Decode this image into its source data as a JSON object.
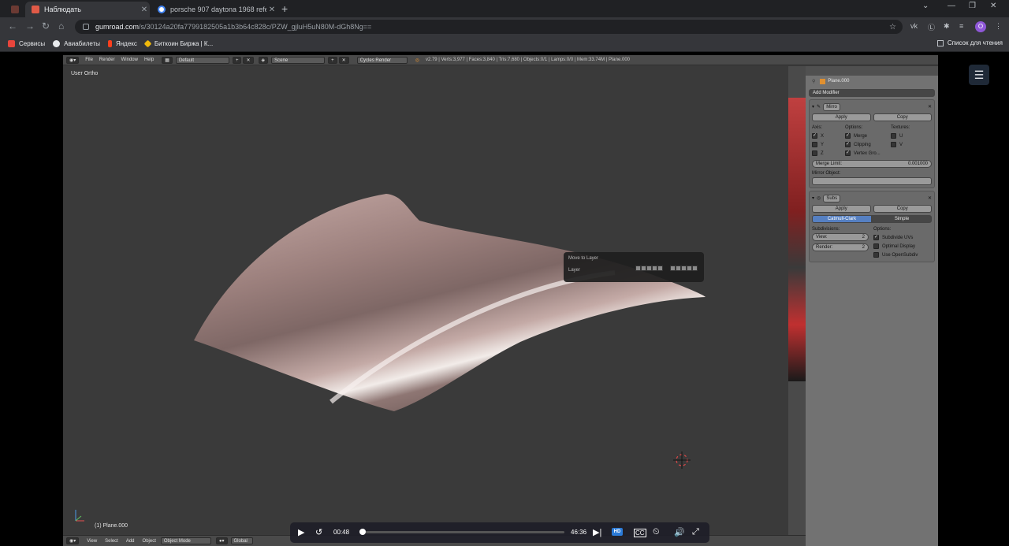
{
  "tabs": [
    {
      "label": "Наблюдать",
      "active": true,
      "favicon_color": "#e05a47"
    },
    {
      "label": "porsche 907 daytona 1968 refere",
      "active": false,
      "favicon_color": "#4285f4"
    }
  ],
  "address": {
    "host": "gumroad.com",
    "path": "/s/30124a20fa7799182505a1b3b64c828c/PZW_gjluH5uN80M-dGh8Ng=="
  },
  "bookmarks": [
    {
      "label": "Сервисы",
      "icon": "apps-icon",
      "color": "#e8453c"
    },
    {
      "label": "Авиабилеты",
      "icon": "plane-icon",
      "color": "#e8eaed"
    },
    {
      "label": "Яндекс",
      "icon": "yandex-icon",
      "color": "#fc3f1d"
    },
    {
      "label": "Биткоин Биржа | К...",
      "icon": "binance-icon",
      "color": "#f0b90b"
    }
  ],
  "reading_list": "Список для чтения",
  "profile_initial": "O",
  "blender": {
    "menus": [
      "File",
      "Render",
      "Window",
      "Help"
    ],
    "layout": "Default",
    "scene": "Scene",
    "engine": "Cycles Render",
    "stats": "v2.79 | Verts:3,977 | Faces:3,840 | Tris:7,680 | Objects:0/1 | Lamps:0/0 | Mem:33.74M | Plane.000",
    "view_label": "User Ortho",
    "object_label": "(1) Plane.000",
    "crumb": "Plane.000",
    "add_modifier": "Add Modifier",
    "mirror": {
      "name": "Mirro",
      "apply": "Apply",
      "copy": "Copy",
      "axis_title": "Axis:",
      "options_title": "Options:",
      "textures_title": "Textures:",
      "axis": [
        "X",
        "Y",
        "Z"
      ],
      "options": [
        "Merge",
        "Clipping",
        "Vertex Gro..."
      ],
      "textures": [
        "U",
        "V"
      ],
      "merge_limit_label": "Merge Limit:",
      "merge_limit_value": "0.001000",
      "mirror_object": "Mirror Object:"
    },
    "subsurf": {
      "name": "Subs",
      "apply": "Apply",
      "copy": "Copy",
      "mode_a": "Catmull-Clark",
      "mode_b": "Simple",
      "subdiv_title": "Subdivisions:",
      "options_title": "Options:",
      "view_label": "View:",
      "view_value": "2",
      "render_label": "Render:",
      "render_value": "2",
      "options": [
        "Subdivide UVs",
        "Optimal Display",
        "Use OpenSubdiv"
      ]
    },
    "popup": {
      "title": "Move to Layer",
      "label": "Layer"
    },
    "footer": {
      "menus": [
        "View",
        "Select",
        "Add",
        "Object"
      ],
      "mode": "Object Mode",
      "orientation": "Global"
    }
  },
  "video": {
    "current": "00:48",
    "total": "46:36",
    "progress": 0.017,
    "hd": "HD"
  }
}
